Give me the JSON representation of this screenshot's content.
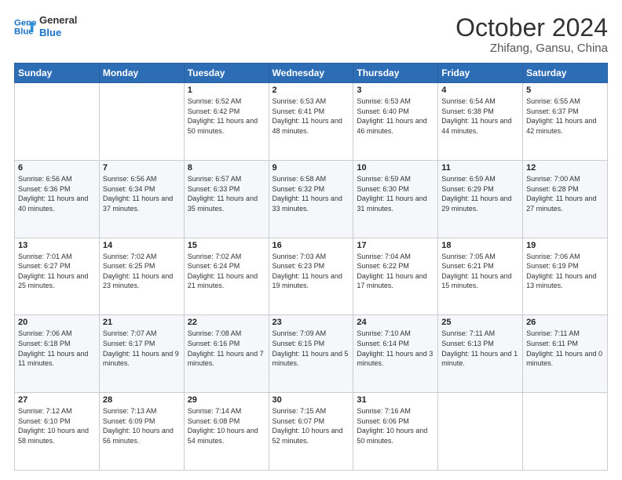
{
  "header": {
    "logo_line1": "General",
    "logo_line2": "Blue",
    "month": "October 2024",
    "location": "Zhifang, Gansu, China"
  },
  "days_of_week": [
    "Sunday",
    "Monday",
    "Tuesday",
    "Wednesday",
    "Thursday",
    "Friday",
    "Saturday"
  ],
  "weeks": [
    [
      {
        "day": "",
        "sunrise": "",
        "sunset": "",
        "daylight": ""
      },
      {
        "day": "",
        "sunrise": "",
        "sunset": "",
        "daylight": ""
      },
      {
        "day": "1",
        "sunrise": "Sunrise: 6:52 AM",
        "sunset": "Sunset: 6:42 PM",
        "daylight": "Daylight: 11 hours and 50 minutes."
      },
      {
        "day": "2",
        "sunrise": "Sunrise: 6:53 AM",
        "sunset": "Sunset: 6:41 PM",
        "daylight": "Daylight: 11 hours and 48 minutes."
      },
      {
        "day": "3",
        "sunrise": "Sunrise: 6:53 AM",
        "sunset": "Sunset: 6:40 PM",
        "daylight": "Daylight: 11 hours and 46 minutes."
      },
      {
        "day": "4",
        "sunrise": "Sunrise: 6:54 AM",
        "sunset": "Sunset: 6:38 PM",
        "daylight": "Daylight: 11 hours and 44 minutes."
      },
      {
        "day": "5",
        "sunrise": "Sunrise: 6:55 AM",
        "sunset": "Sunset: 6:37 PM",
        "daylight": "Daylight: 11 hours and 42 minutes."
      }
    ],
    [
      {
        "day": "6",
        "sunrise": "Sunrise: 6:56 AM",
        "sunset": "Sunset: 6:36 PM",
        "daylight": "Daylight: 11 hours and 40 minutes."
      },
      {
        "day": "7",
        "sunrise": "Sunrise: 6:56 AM",
        "sunset": "Sunset: 6:34 PM",
        "daylight": "Daylight: 11 hours and 37 minutes."
      },
      {
        "day": "8",
        "sunrise": "Sunrise: 6:57 AM",
        "sunset": "Sunset: 6:33 PM",
        "daylight": "Daylight: 11 hours and 35 minutes."
      },
      {
        "day": "9",
        "sunrise": "Sunrise: 6:58 AM",
        "sunset": "Sunset: 6:32 PM",
        "daylight": "Daylight: 11 hours and 33 minutes."
      },
      {
        "day": "10",
        "sunrise": "Sunrise: 6:59 AM",
        "sunset": "Sunset: 6:30 PM",
        "daylight": "Daylight: 11 hours and 31 minutes."
      },
      {
        "day": "11",
        "sunrise": "Sunrise: 6:59 AM",
        "sunset": "Sunset: 6:29 PM",
        "daylight": "Daylight: 11 hours and 29 minutes."
      },
      {
        "day": "12",
        "sunrise": "Sunrise: 7:00 AM",
        "sunset": "Sunset: 6:28 PM",
        "daylight": "Daylight: 11 hours and 27 minutes."
      }
    ],
    [
      {
        "day": "13",
        "sunrise": "Sunrise: 7:01 AM",
        "sunset": "Sunset: 6:27 PM",
        "daylight": "Daylight: 11 hours and 25 minutes."
      },
      {
        "day": "14",
        "sunrise": "Sunrise: 7:02 AM",
        "sunset": "Sunset: 6:25 PM",
        "daylight": "Daylight: 11 hours and 23 minutes."
      },
      {
        "day": "15",
        "sunrise": "Sunrise: 7:02 AM",
        "sunset": "Sunset: 6:24 PM",
        "daylight": "Daylight: 11 hours and 21 minutes."
      },
      {
        "day": "16",
        "sunrise": "Sunrise: 7:03 AM",
        "sunset": "Sunset: 6:23 PM",
        "daylight": "Daylight: 11 hours and 19 minutes."
      },
      {
        "day": "17",
        "sunrise": "Sunrise: 7:04 AM",
        "sunset": "Sunset: 6:22 PM",
        "daylight": "Daylight: 11 hours and 17 minutes."
      },
      {
        "day": "18",
        "sunrise": "Sunrise: 7:05 AM",
        "sunset": "Sunset: 6:21 PM",
        "daylight": "Daylight: 11 hours and 15 minutes."
      },
      {
        "day": "19",
        "sunrise": "Sunrise: 7:06 AM",
        "sunset": "Sunset: 6:19 PM",
        "daylight": "Daylight: 11 hours and 13 minutes."
      }
    ],
    [
      {
        "day": "20",
        "sunrise": "Sunrise: 7:06 AM",
        "sunset": "Sunset: 6:18 PM",
        "daylight": "Daylight: 11 hours and 11 minutes."
      },
      {
        "day": "21",
        "sunrise": "Sunrise: 7:07 AM",
        "sunset": "Sunset: 6:17 PM",
        "daylight": "Daylight: 11 hours and 9 minutes."
      },
      {
        "day": "22",
        "sunrise": "Sunrise: 7:08 AM",
        "sunset": "Sunset: 6:16 PM",
        "daylight": "Daylight: 11 hours and 7 minutes."
      },
      {
        "day": "23",
        "sunrise": "Sunrise: 7:09 AM",
        "sunset": "Sunset: 6:15 PM",
        "daylight": "Daylight: 11 hours and 5 minutes."
      },
      {
        "day": "24",
        "sunrise": "Sunrise: 7:10 AM",
        "sunset": "Sunset: 6:14 PM",
        "daylight": "Daylight: 11 hours and 3 minutes."
      },
      {
        "day": "25",
        "sunrise": "Sunrise: 7:11 AM",
        "sunset": "Sunset: 6:13 PM",
        "daylight": "Daylight: 11 hours and 1 minute."
      },
      {
        "day": "26",
        "sunrise": "Sunrise: 7:11 AM",
        "sunset": "Sunset: 6:11 PM",
        "daylight": "Daylight: 11 hours and 0 minutes."
      }
    ],
    [
      {
        "day": "27",
        "sunrise": "Sunrise: 7:12 AM",
        "sunset": "Sunset: 6:10 PM",
        "daylight": "Daylight: 10 hours and 58 minutes."
      },
      {
        "day": "28",
        "sunrise": "Sunrise: 7:13 AM",
        "sunset": "Sunset: 6:09 PM",
        "daylight": "Daylight: 10 hours and 56 minutes."
      },
      {
        "day": "29",
        "sunrise": "Sunrise: 7:14 AM",
        "sunset": "Sunset: 6:08 PM",
        "daylight": "Daylight: 10 hours and 54 minutes."
      },
      {
        "day": "30",
        "sunrise": "Sunrise: 7:15 AM",
        "sunset": "Sunset: 6:07 PM",
        "daylight": "Daylight: 10 hours and 52 minutes."
      },
      {
        "day": "31",
        "sunrise": "Sunrise: 7:16 AM",
        "sunset": "Sunset: 6:06 PM",
        "daylight": "Daylight: 10 hours and 50 minutes."
      },
      {
        "day": "",
        "sunrise": "",
        "sunset": "",
        "daylight": ""
      },
      {
        "day": "",
        "sunrise": "",
        "sunset": "",
        "daylight": ""
      }
    ]
  ]
}
